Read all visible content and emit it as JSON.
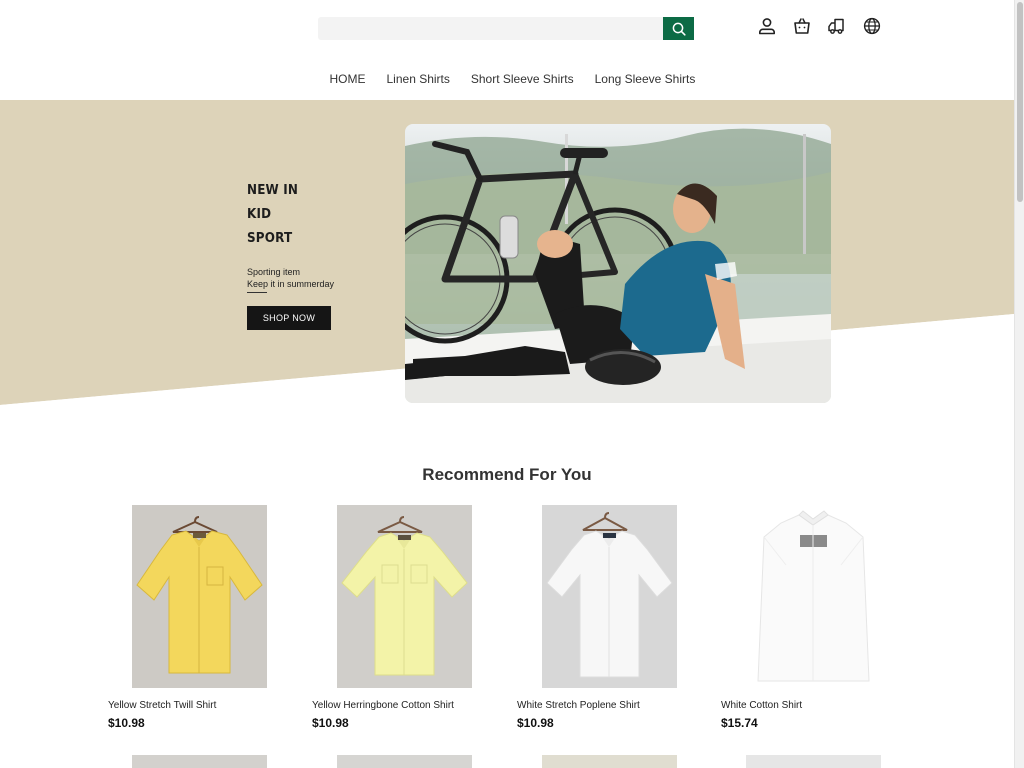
{
  "search": {
    "value": "",
    "placeholder": ""
  },
  "header_icons": [
    "user-icon",
    "shopping-bag-icon",
    "shipping-truck-icon",
    "globe-icon"
  ],
  "nav": [
    {
      "label": "HOME"
    },
    {
      "label": "Linen Shirts"
    },
    {
      "label": "Short Sleeve Shirts"
    },
    {
      "label": "Long Sleeve Shirts"
    }
  ],
  "hero": {
    "lines": [
      "NEW IN",
      "KID",
      "SPORT"
    ],
    "sub1": "Sporting item",
    "sub2": "Keep it in summerday",
    "button": "SHOP NOW",
    "bg_color": "#ddd3b9"
  },
  "recommend": {
    "title": "Recommend For You",
    "products": [
      {
        "name": "Yellow Stretch Twill Shirt",
        "price": "$10.98",
        "shirt_color": "#f3d75c"
      },
      {
        "name": "Yellow Herringbone Cotton Shirt",
        "price": "$10.98",
        "shirt_color": "#f3f3a8"
      },
      {
        "name": "White Stretch Poplene Shirt",
        "price": "$10.98",
        "shirt_color": "#f7f7f7"
      },
      {
        "name": "White Cotton Shirt",
        "price": "$15.74",
        "shirt_color": "#fafafa"
      }
    ]
  },
  "colors": {
    "accent": "#0c6b45",
    "button_dark": "#151515"
  }
}
